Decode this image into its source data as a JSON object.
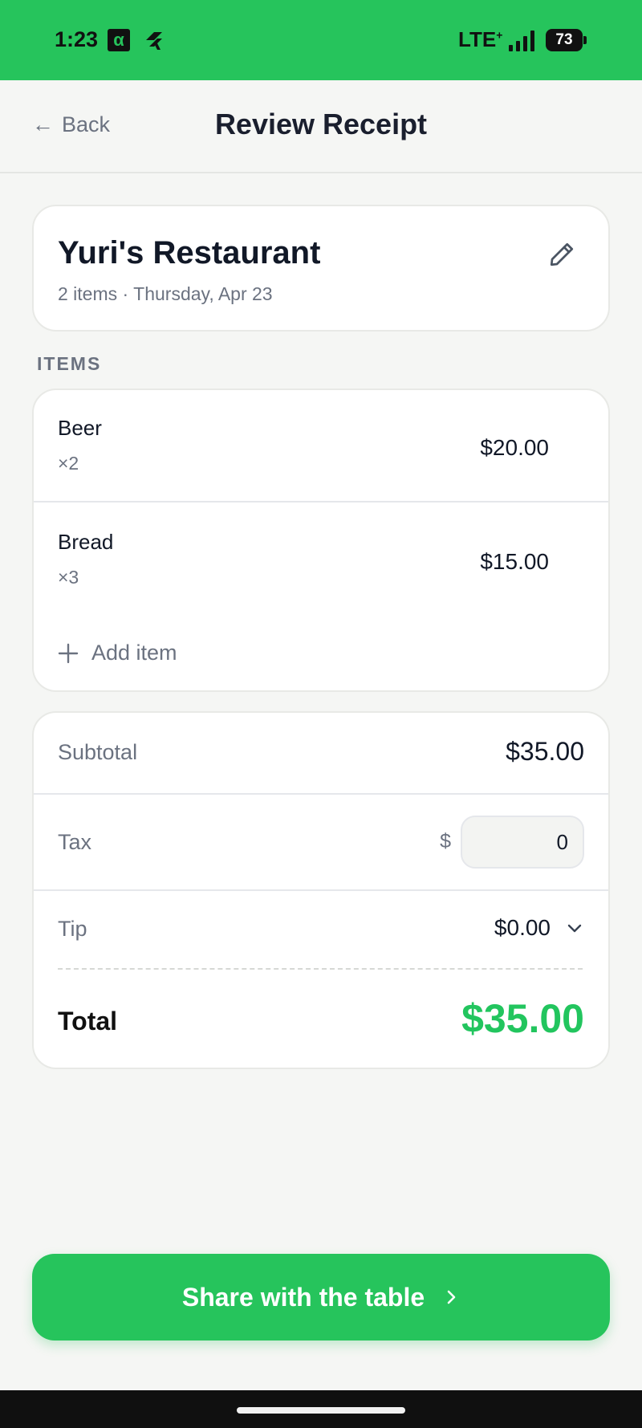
{
  "status_bar": {
    "time": "1:23",
    "alpha_icon": "α",
    "network": "LTE",
    "network_sup": "+",
    "battery": "73"
  },
  "nav": {
    "back_arrow": "←",
    "back_label": "Back",
    "title": "Review Receipt"
  },
  "receipt": {
    "restaurant": "Yuri's Restaurant",
    "meta": "2 items · Thursday, Apr 23"
  },
  "items_section": {
    "label": "ITEMS",
    "items": [
      {
        "name": "Beer",
        "qty": "×2",
        "price": "$20.00"
      },
      {
        "name": "Bread",
        "qty": "×3",
        "price": "$15.00"
      }
    ],
    "add_label": "Add item"
  },
  "totals": {
    "subtotal_label": "Subtotal",
    "subtotal_value": "$35.00",
    "tax_label": "Tax",
    "tax_currency": "$",
    "tax_value": "0",
    "tip_label": "Tip",
    "tip_value": "$0.00",
    "total_label": "Total",
    "total_value": "$35.00"
  },
  "actions": {
    "share_label": "Share with the table"
  },
  "colors": {
    "accent": "#26c45c",
    "total_green": "#22c55e",
    "muted_text": "#6b7280",
    "background": "#f5f6f4"
  },
  "icons": [
    "alpha-icon",
    "app-icon",
    "signal-icon",
    "battery-icon",
    "back-arrow-icon",
    "edit-pencil-icon",
    "plus-icon",
    "chevron-down-icon",
    "chevron-right-icon"
  ]
}
